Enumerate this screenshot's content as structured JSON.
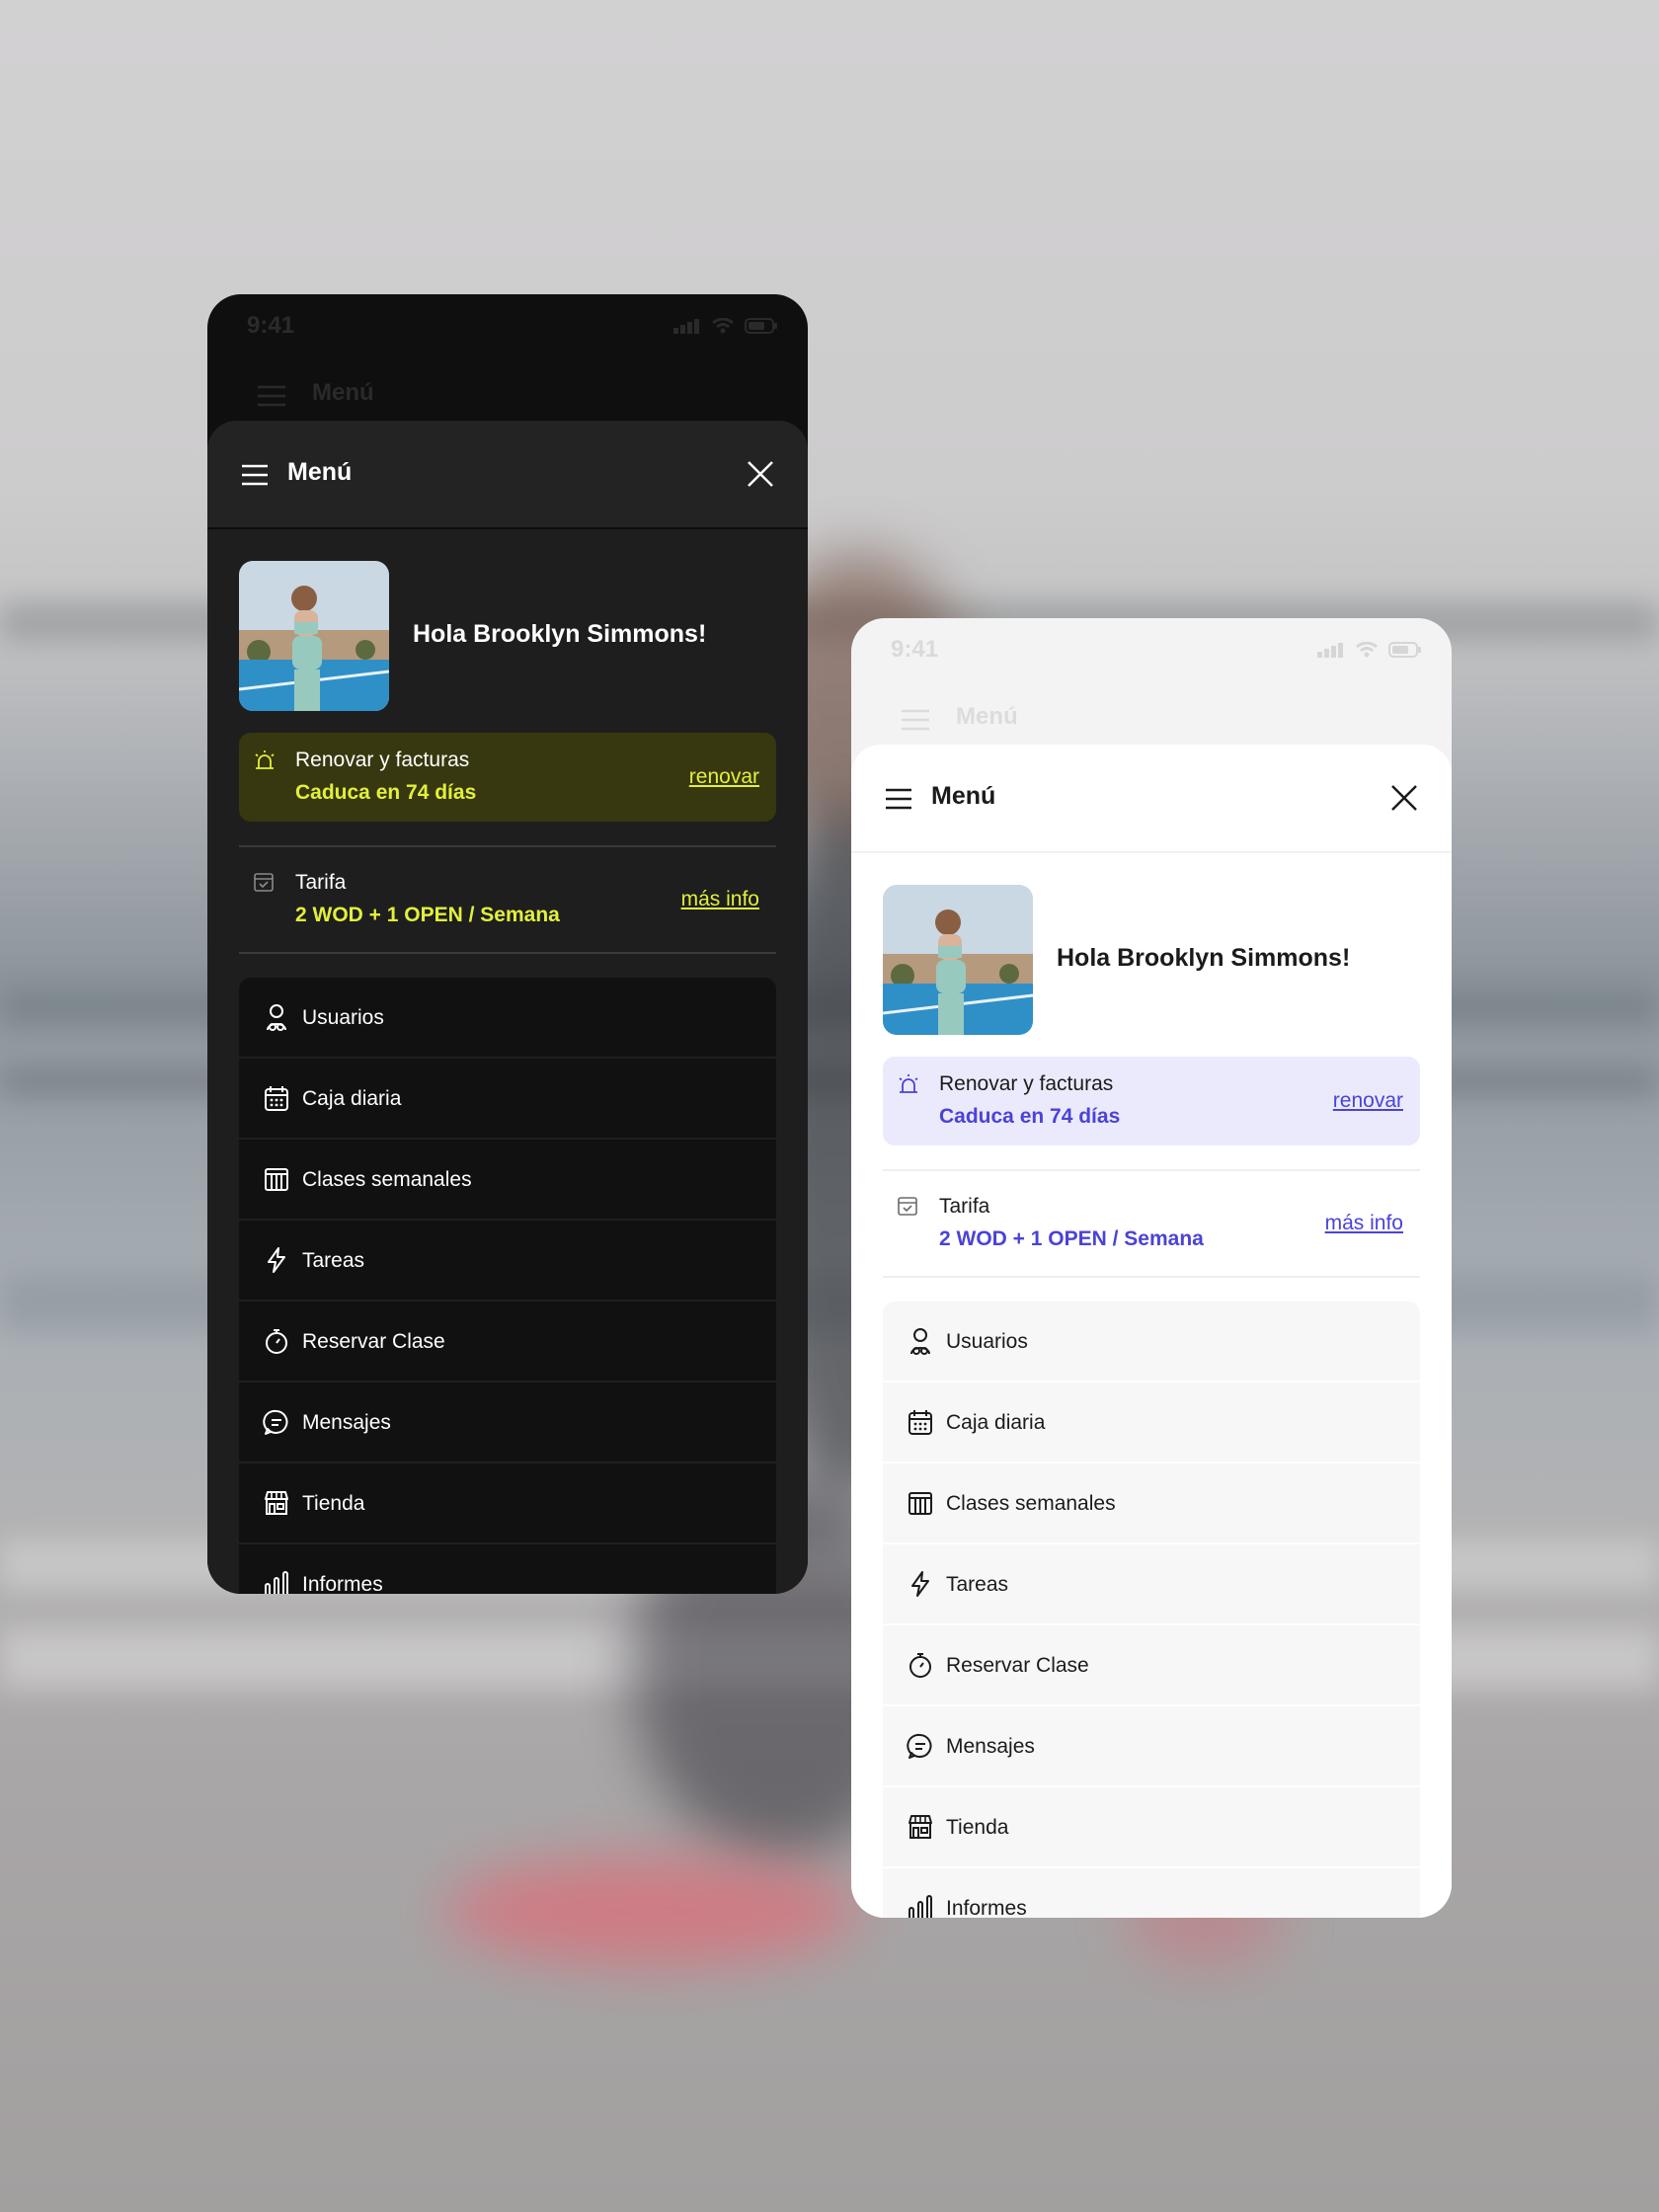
{
  "screens": {
    "dark": {
      "status_time": "9:41",
      "ghost_title": "Menú",
      "header_title": "Menú",
      "greeting": "Hola Brooklyn Simmons!",
      "alert": {
        "title": "Renovar y facturas",
        "subtitle": "Caduca en 74 días",
        "link": "renovar"
      },
      "tarifa": {
        "title": "Tarifa",
        "value": "2 WOD + 1 OPEN / Semana",
        "link": "más info"
      },
      "nav": [
        {
          "label": "Usuarios",
          "icon": "user-icon"
        },
        {
          "label": "Caja diaria",
          "icon": "cash-register-icon"
        },
        {
          "label": "Clases semanales",
          "icon": "calendar-columns-icon"
        },
        {
          "label": "Tareas",
          "icon": "lightning-icon"
        },
        {
          "label": "Reservar Clase",
          "icon": "stopwatch-icon"
        },
        {
          "label": "Mensajes",
          "icon": "chat-icon"
        },
        {
          "label": "Tienda",
          "icon": "store-icon"
        },
        {
          "label": "Informes",
          "icon": "bar-chart-icon"
        }
      ]
    },
    "light": {
      "status_time": "9:41",
      "ghost_title": "Menú",
      "header_title": "Menú",
      "greeting": "Hola Brooklyn Simmons!",
      "alert": {
        "title": "Renovar y facturas",
        "subtitle": "Caduca en 74 días",
        "link": "renovar"
      },
      "tarifa": {
        "title": "Tarifa",
        "value": "2 WOD + 1 OPEN / Semana",
        "link": "más info"
      },
      "nav": [
        {
          "label": "Usuarios",
          "icon": "user-icon"
        },
        {
          "label": "Caja diaria",
          "icon": "cash-register-icon"
        },
        {
          "label": "Clases semanales",
          "icon": "calendar-columns-icon"
        },
        {
          "label": "Tareas",
          "icon": "lightning-icon"
        },
        {
          "label": "Reservar Clase",
          "icon": "stopwatch-icon"
        },
        {
          "label": "Mensajes",
          "icon": "chat-icon"
        },
        {
          "label": "Tienda",
          "icon": "store-icon"
        },
        {
          "label": "Informes",
          "icon": "bar-chart-icon"
        }
      ]
    }
  },
  "colors": {
    "dark_accent": "#e2f03a",
    "light_accent": "#4b43d6",
    "dark_alert_bg": "#373810",
    "light_alert_bg": "#ebeafd"
  }
}
